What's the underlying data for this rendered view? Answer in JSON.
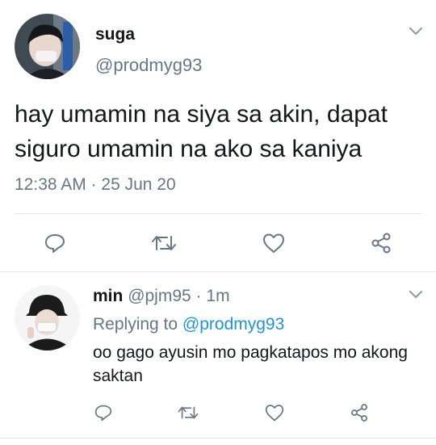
{
  "tweet": {
    "author_name": "suga",
    "author_handle": "@prodmyg93",
    "text": "hay umamin na siya sa akin, dapat siguro umamin na ako sa kaniya",
    "time": "12:38 AM",
    "separator": "·",
    "date": "25 Jun 20",
    "actions": [
      "reply-icon",
      "retweet-icon",
      "like-icon",
      "share-icon"
    ]
  },
  "reply": {
    "author_name": "min",
    "author_handle": "@pjm95",
    "separator": "·",
    "age": "1m",
    "replying_to_label": "Replying to",
    "replying_to_handle": "@prodmyg93",
    "text": "oo gago ayusin mo pagkatapos mo akong saktan",
    "actions": [
      "reply-icon",
      "retweet-icon",
      "like-icon",
      "share-icon"
    ]
  },
  "colors": {
    "text": "#14171a",
    "secondary": "#657786",
    "accent": "#1b95e0",
    "divider": "#e1e8ed"
  }
}
